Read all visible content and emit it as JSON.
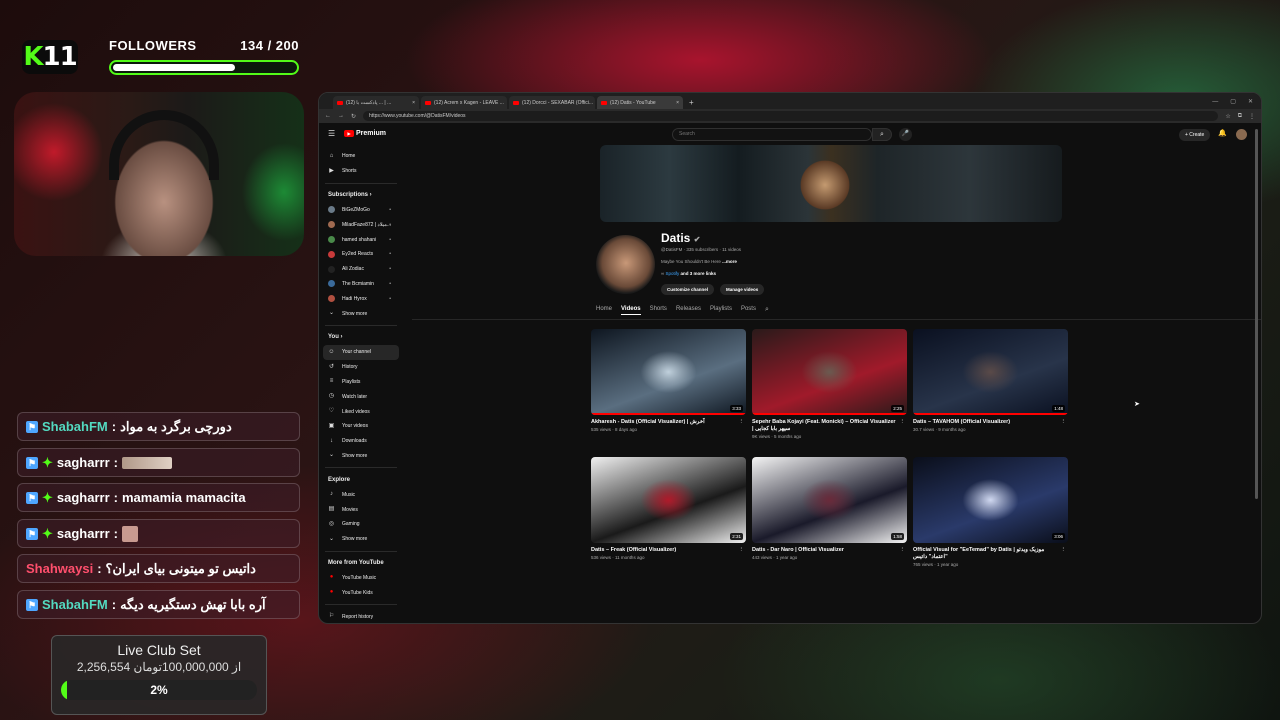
{
  "overlay": {
    "logo": {
      "k": "K",
      "n": "11"
    },
    "followers": {
      "label": "FOLLOWERS",
      "count": "134 / 200",
      "progress": 0.67
    },
    "chat": [
      {
        "user": "ShabahFM",
        "sep": " : ",
        "msg": "دورچی برگرد به مواد",
        "color": "#53d9c0",
        "emote": null
      },
      {
        "user": "sagharrr",
        "sep": " : ",
        "msg": "",
        "color": "#ffffff",
        "emote": "wide"
      },
      {
        "user": "sagharrr",
        "sep": " : ",
        "msg": "mamamia mamacita",
        "color": "#ffffff",
        "emote": null
      },
      {
        "user": "sagharrr",
        "sep": " : ",
        "msg": "",
        "color": "#ffffff",
        "emote": "square"
      },
      {
        "user": "Shahwaysi",
        "sep": " : ",
        "msg": "داتیس تو میتونی بیای ایران؟",
        "color": "#ff4f6d",
        "emote": null
      },
      {
        "user": "ShabahFM",
        "sep": " : ",
        "msg": "آره بابا تهش دستگیریه دیگه",
        "color": "#53d9c0",
        "emote": null
      }
    ],
    "club": {
      "title": "Live Club Set",
      "amount": "2,256,554 از 100,000,000تومان",
      "percent_label": "2%",
      "progress": 0.02
    }
  },
  "browser": {
    "tabs": [
      "(12) پادکست با ... | ...",
      "(12) Acrem x Kagen - LEAVE ...",
      "(12) Dorcci - SEXABAR (Offici...",
      "(12) Datis - YouTube"
    ],
    "new_tab": "+",
    "url": "https://www.youtube.com/@DatisFM/videos"
  },
  "youtube": {
    "logo": "Premium",
    "search_placeholder": "Search",
    "create": "+ Create",
    "sidebar": {
      "main": [
        {
          "label": "Home",
          "icon": "⌂"
        },
        {
          "label": "Shorts",
          "icon": "▶"
        }
      ],
      "subs_header": "Subscriptions  ›",
      "subs": [
        {
          "label": "BiGeZMoGo",
          "color": "#6a7a88"
        },
        {
          "label": "MiladFaze872 | میلاد...",
          "color": "#a06a50"
        },
        {
          "label": "hamed shahani",
          "color": "#4a8a4a"
        },
        {
          "label": "Ey2ed Reacts",
          "color": "#c83a3a"
        },
        {
          "label": "Ali Zodiac",
          "color": "#222222"
        },
        {
          "label": "The Bcmiamin",
          "color": "#3a6a9a"
        },
        {
          "label": "Hadi Hyrox",
          "color": "#b05040"
        }
      ],
      "show_more": "Show more",
      "you_header": "You  ›",
      "you": [
        {
          "label": "Your channel",
          "icon": "☺"
        },
        {
          "label": "History",
          "icon": "↺"
        },
        {
          "label": "Playlists",
          "icon": "≡"
        },
        {
          "label": "Watch later",
          "icon": "◷"
        },
        {
          "label": "Liked videos",
          "icon": "♡"
        },
        {
          "label": "Your videos",
          "icon": "▣"
        },
        {
          "label": "Downloads",
          "icon": "↓"
        }
      ],
      "explore_header": "Explore",
      "explore": [
        {
          "label": "Music",
          "icon": "♪"
        },
        {
          "label": "Movies",
          "icon": "▤"
        },
        {
          "label": "Gaming",
          "icon": "◎"
        }
      ],
      "more_header": "More from YouTube",
      "more": [
        {
          "label": "YouTube Music",
          "icon": "●"
        },
        {
          "label": "YouTube Kids",
          "icon": "●"
        }
      ],
      "report": "Report history"
    },
    "channel": {
      "name": "Datis",
      "handle_meta": "@DatisFM · 335 subscribers · 11 videos",
      "desc": "Maybe You Shouldn't Be Here",
      "more": "...more",
      "link": "Spotify",
      "link_more": "and 3 more links",
      "customize": "Customize channel",
      "manage": "Manage videos",
      "tabs": [
        "Home",
        "Videos",
        "Shorts",
        "Releases",
        "Playlists",
        "Posts"
      ]
    },
    "videos": [
      {
        "title": "Akharesh - Datis (Official Visualizer) | آخرش",
        "meta": "535 views · 8 days ago",
        "dur": "3:33",
        "colors": [
          "#0e1620",
          "#5a6e80",
          "#c0d0dc"
        ]
      },
      {
        "title": "Sepehr Baba Kojayi (Feat. Monicki) – Official Visualizer | سپهر بابا کجایی",
        "meta": "9K views · 5 months ago",
        "dur": "2:25",
        "colors": [
          "#2a1a1a",
          "#a01a2a",
          "#6a5a50"
        ]
      },
      {
        "title": "Datis – TAVAHOM (Official Visualizer)",
        "meta": "30.7 views · 9 months ago",
        "dur": "1:48",
        "colors": [
          "#0a1020",
          "#28344a",
          "#5a4a48"
        ]
      },
      {
        "title": "Datis – Freak (Official Visualizer)",
        "meta": "536 views · 11 months ago",
        "dur": "2:31",
        "colors": [
          "#f0f0f0",
          "#1a1a1a",
          "#b01a2a"
        ]
      },
      {
        "title": "Datis - Dar Naro | Official Visualizer",
        "meta": "443 views · 1 year ago",
        "dur": "1:58",
        "colors": [
          "#f4f4f4",
          "#1a1a2a",
          "#6a2a3a"
        ]
      },
      {
        "title": "Official Visual for \"EeTemad\" by Datis | موزیک ویدئو \"اعتماد\" داتیس",
        "meta": "765 views · 1 year ago",
        "dur": "3:06",
        "colors": [
          "#0a0e1a",
          "#2a3a6a",
          "#d0d8f0"
        ]
      }
    ]
  }
}
